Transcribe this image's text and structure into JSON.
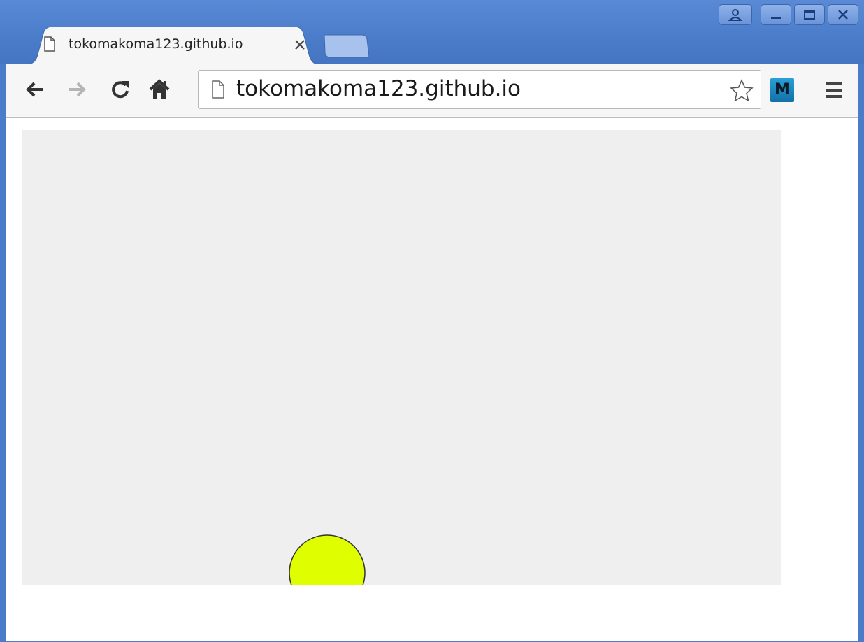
{
  "browser": {
    "tab": {
      "title": "tokomakoma123.github.io"
    },
    "omnibox": {
      "url": "tokomakoma123.github.io"
    },
    "extension": {
      "label": "M"
    }
  },
  "icons": {
    "profile": "profile-icon",
    "minimize": "minimize-icon",
    "maximize": "maximize-icon",
    "close": "close-icon",
    "back": "back-arrow-icon",
    "forward": "forward-arrow-icon",
    "reload": "reload-icon",
    "home": "home-icon",
    "page": "page-icon",
    "bookmark": "star-icon",
    "menu": "hamburger-menu-icon"
  },
  "colors": {
    "frame": "#4a7cc9",
    "canvas_bg": "#efefef",
    "ball_fill": "#dfff00",
    "ball_stroke": "#333333"
  }
}
